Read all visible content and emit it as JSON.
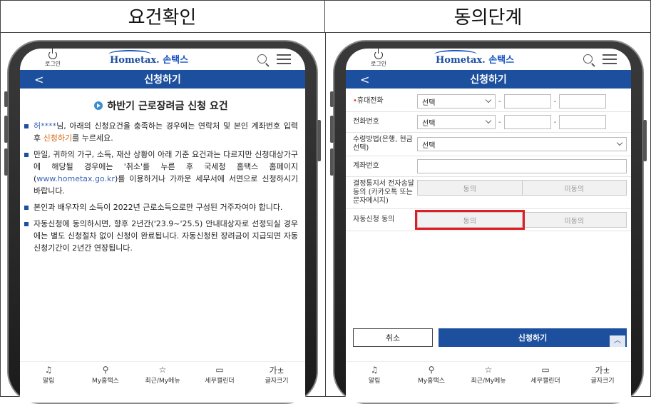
{
  "headers": {
    "left": "요건확인",
    "right": "동의단계"
  },
  "app": {
    "login_label": "로그인",
    "logo_main": "Hometax.",
    "logo_sub": "손택스"
  },
  "left_screen": {
    "page_title": "신청하기",
    "section_title": "하반기 근로장려금 신청 요건",
    "p1_name": "허****",
    "p1_a": "님, 아래의 신청요건을 충족하는 경우에는 연락처 및 본인 계좌번호 입력 후 ",
    "p1_link": "신청하기",
    "p1_b": "를 누르세요.",
    "p2_a": "만일, 귀하의 가구, 소득, 재산 상황이 아래 기준 요건과는 다르지만 신청대상가구에 해당될 경우에는 '취소'를 누른 후 국세청 홈택스 홈페이지(",
    "p2_url": "www.hometax.go.kr",
    "p2_b": ")를 이용하거나 가까운 세무서에 서면으로 신청하시기 바랍니다.",
    "p3": "본인과 배우자의 소득이 2022년 근로소득으로만 구성된 거주자여야 합니다.",
    "p4": "자동신청에 동의하시면, 향후 2년간('23.9~'25.5) 안내대상자로 선정되실 경우에는 별도 신청절차 없이 신청이 완료됩니다. 자동신청된 장려금이 지급되면 자동신청기간이 2년간 연장됩니다."
  },
  "right_screen": {
    "page_title": "신청하기",
    "mobile_label": "휴대전화",
    "mobile_select": "선택",
    "phone_label": "전화번호",
    "phone_select": "선택",
    "receive_label": "수령방법(은행, 현금선택)",
    "receive_select": "선택",
    "account_label": "계좌번호",
    "notice_label": "결정통지서 전자송달 동의 (카카오톡 또는 문자메시지)",
    "notice_agree": "동의",
    "notice_disagree": "미동의",
    "auto_label": "자동신청 동의",
    "auto_agree": "동의",
    "auto_disagree": "미동의",
    "cancel": "취소",
    "submit": "신청하기"
  },
  "bottom_nav": {
    "item1": "알림",
    "item2": "My홈택스",
    "item3": "최근/My메뉴",
    "item4": "세무캘린더",
    "item5": "글자크기",
    "item5_icon": "가±"
  },
  "colors": {
    "primary": "#1c4f9e",
    "highlight": "#e11d24",
    "link_orange": "#d96a15"
  }
}
